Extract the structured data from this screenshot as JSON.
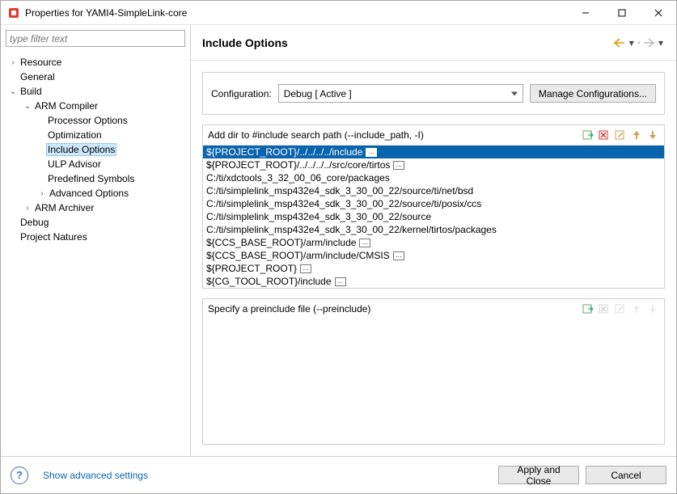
{
  "window": {
    "title": "Properties for YAMI4-SimpleLink-core"
  },
  "filter": {
    "placeholder": "type filter text"
  },
  "tree": {
    "resource": "Resource",
    "general": "General",
    "build": "Build",
    "arm_compiler": "ARM Compiler",
    "processor_options": "Processor Options",
    "optimization": "Optimization",
    "include_options": "Include Options",
    "ulp_advisor": "ULP Advisor",
    "predefined_symbols": "Predefined Symbols",
    "advanced_options": "Advanced Options",
    "arm_archiver": "ARM Archiver",
    "debug": "Debug",
    "project_natures": "Project Natures"
  },
  "header": {
    "title": "Include Options"
  },
  "config": {
    "label": "Configuration:",
    "value": "Debug  [ Active ]",
    "manage_btn": "Manage Configurations..."
  },
  "include_list": {
    "title": "Add dir to #include search path (--include_path, -I)",
    "items": [
      {
        "text": "${PROJECT_ROOT}/../../../../include",
        "ellipsis": true
      },
      {
        "text": "${PROJECT_ROOT}/../../../../src/core/tirtos",
        "ellipsis": true
      },
      {
        "text": "C:/ti/xdctools_3_32_00_06_core/packages",
        "ellipsis": false
      },
      {
        "text": "C:/ti/simplelink_msp432e4_sdk_3_30_00_22/source/ti/net/bsd",
        "ellipsis": false
      },
      {
        "text": "C:/ti/simplelink_msp432e4_sdk_3_30_00_22/source/ti/posix/ccs",
        "ellipsis": false
      },
      {
        "text": "C:/ti/simplelink_msp432e4_sdk_3_30_00_22/source",
        "ellipsis": false
      },
      {
        "text": "C:/ti/simplelink_msp432e4_sdk_3_30_00_22/kernel/tirtos/packages",
        "ellipsis": false
      },
      {
        "text": "${CCS_BASE_ROOT}/arm/include",
        "ellipsis": true
      },
      {
        "text": "${CCS_BASE_ROOT}/arm/include/CMSIS",
        "ellipsis": true
      },
      {
        "text": "${PROJECT_ROOT}",
        "ellipsis": true
      },
      {
        "text": "${CG_TOOL_ROOT}/include",
        "ellipsis": true
      }
    ]
  },
  "preinclude": {
    "title": "Specify a preinclude file (--preinclude)"
  },
  "footer": {
    "advanced": "Show advanced settings",
    "apply": "Apply and Close",
    "cancel": "Cancel"
  }
}
